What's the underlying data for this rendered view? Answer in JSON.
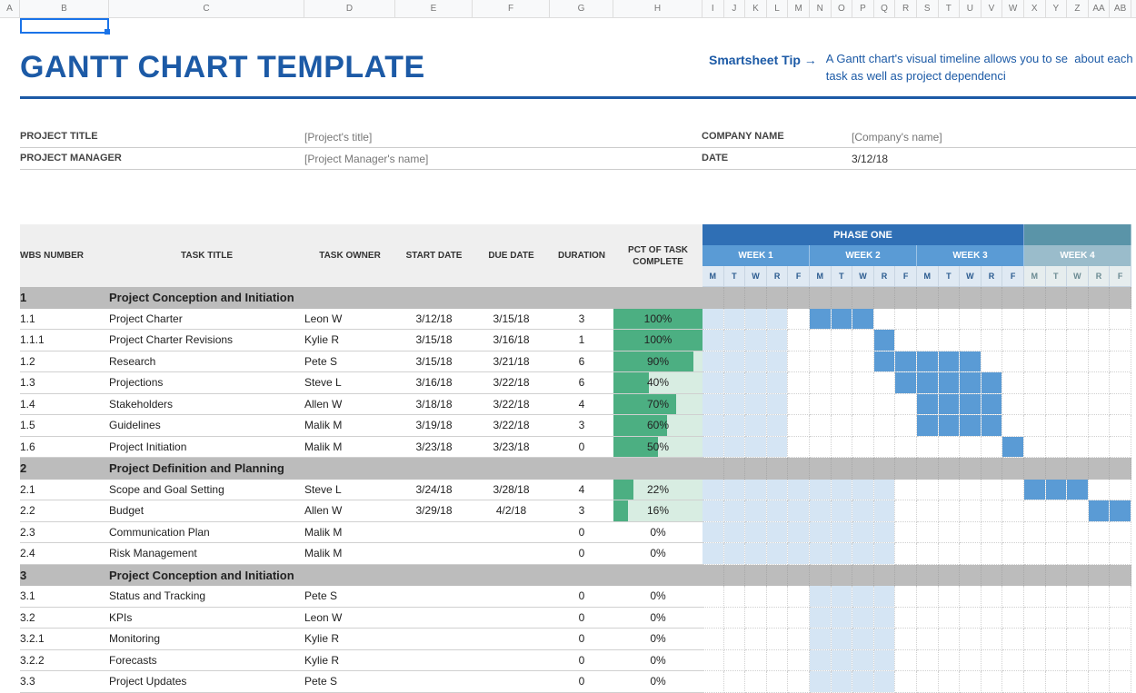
{
  "columns_letters": [
    "A",
    "B",
    "C",
    "D",
    "E",
    "F",
    "G",
    "H",
    "I",
    "J",
    "K",
    "L",
    "M",
    "N",
    "O",
    "P",
    "Q",
    "R",
    "S",
    "T",
    "U",
    "V",
    "W",
    "X",
    "Y",
    "Z",
    "AA",
    "AB"
  ],
  "title": "GANTT CHART TEMPLATE",
  "tip": {
    "label": "Smartsheet Tip",
    "arrow": "→",
    "text": "A Gantt chart's visual timeline allows you to se  about each task as well as project dependenci"
  },
  "meta": {
    "project_title_label": "PROJECT TITLE",
    "project_title_value": "[Project's title]",
    "project_manager_label": "PROJECT MANAGER",
    "project_manager_value": "[Project Manager's name]",
    "company_name_label": "COMPANY NAME",
    "company_name_value": "[Company's name]",
    "date_label": "DATE",
    "date_value": "3/12/18"
  },
  "headers": {
    "wbs": "WBS NUMBER",
    "task": "TASK TITLE",
    "owner": "TASK OWNER",
    "start": "START DATE",
    "due": "DUE DATE",
    "duration": "DURATION",
    "pct": "PCT OF TASK COMPLETE"
  },
  "timeline": {
    "phase_one": "PHASE ONE",
    "weeks": [
      "WEEK 1",
      "WEEK 2",
      "WEEK 3",
      "WEEK 4"
    ],
    "days": [
      "M",
      "T",
      "W",
      "R",
      "F",
      "M",
      "T",
      "W",
      "R",
      "F",
      "M",
      "T",
      "W",
      "R",
      "F",
      "M",
      "T",
      "W",
      "R",
      "F"
    ]
  },
  "chart_data": {
    "type": "gantt",
    "sections": [
      {
        "wbs": "1",
        "title": "Project Conception and Initiation",
        "tasks": [
          {
            "wbs": "1.1",
            "title": "Project Charter",
            "owner": "Leon W",
            "start": "3/12/18",
            "due": "3/15/18",
            "duration": 3,
            "pct": 100,
            "bar_start": 0,
            "bar_len": 4,
            "selected_start": 5,
            "selected_len": 3
          },
          {
            "wbs": "1.1.1",
            "title": "Project Charter Revisions",
            "owner": "Kylie R",
            "start": "3/15/18",
            "due": "3/16/18",
            "duration": 1,
            "pct": 100,
            "bar_start": 0,
            "bar_len": 4,
            "selected_start": 8,
            "selected_len": 1
          },
          {
            "wbs": "1.2",
            "title": "Research",
            "owner": "Pete S",
            "start": "3/15/18",
            "due": "3/21/18",
            "duration": 6,
            "pct": 90,
            "bar_start": 0,
            "bar_len": 4,
            "selected_start": 8,
            "selected_len": 5
          },
          {
            "wbs": "1.3",
            "title": "Projections",
            "owner": "Steve L",
            "start": "3/16/18",
            "due": "3/22/18",
            "duration": 6,
            "pct": 40,
            "bar_start": 0,
            "bar_len": 4,
            "selected_start": 9,
            "selected_len": 5
          },
          {
            "wbs": "1.4",
            "title": "Stakeholders",
            "owner": "Allen W",
            "start": "3/18/18",
            "due": "3/22/18",
            "duration": 4,
            "pct": 70,
            "bar_start": 0,
            "bar_len": 4,
            "selected_start": 10,
            "selected_len": 4
          },
          {
            "wbs": "1.5",
            "title": "Guidelines",
            "owner": "Malik M",
            "start": "3/19/18",
            "due": "3/22/18",
            "duration": 3,
            "pct": 60,
            "bar_start": 0,
            "bar_len": 4,
            "selected_start": 10,
            "selected_len": 4
          },
          {
            "wbs": "1.6",
            "title": "Project Initiation",
            "owner": "Malik M",
            "start": "3/23/18",
            "due": "3/23/18",
            "duration": 0,
            "pct": 50,
            "bar_start": 0,
            "bar_len": 4,
            "selected_start": 14,
            "selected_len": 1
          }
        ]
      },
      {
        "wbs": "2",
        "title": "Project Definition and Planning",
        "tasks": [
          {
            "wbs": "2.1",
            "title": "Scope and Goal Setting",
            "owner": "Steve L",
            "start": "3/24/18",
            "due": "3/28/18",
            "duration": 4,
            "pct": 22,
            "bar_start": 0,
            "bar_len": 9,
            "selected_start": 15,
            "selected_len": 3
          },
          {
            "wbs": "2.2",
            "title": "Budget",
            "owner": "Allen W",
            "start": "3/29/18",
            "due": "4/2/18",
            "duration": 3,
            "pct": 16,
            "bar_start": 0,
            "bar_len": 9,
            "selected_start": 18,
            "selected_len": 2
          },
          {
            "wbs": "2.3",
            "title": "Communication Plan",
            "owner": "Malik M",
            "start": "",
            "due": "",
            "duration": 0,
            "pct": 0,
            "bar_start": 0,
            "bar_len": 9,
            "selected_start": -1,
            "selected_len": 0
          },
          {
            "wbs": "2.4",
            "title": "Risk Management",
            "owner": "Malik M",
            "start": "",
            "due": "",
            "duration": 0,
            "pct": 0,
            "bar_start": 0,
            "bar_len": 9,
            "selected_start": -1,
            "selected_len": 0
          }
        ]
      },
      {
        "wbs": "3",
        "title": "Project Conception and Initiation",
        "tasks": [
          {
            "wbs": "3.1",
            "title": "Status and Tracking",
            "owner": "Pete S",
            "start": "",
            "due": "",
            "duration": 0,
            "pct": 0,
            "bar_start": 5,
            "bar_len": 4,
            "selected_start": -1,
            "selected_len": 0
          },
          {
            "wbs": "3.2",
            "title": "KPIs",
            "owner": "Leon W",
            "start": "",
            "due": "",
            "duration": 0,
            "pct": 0,
            "bar_start": 5,
            "bar_len": 4,
            "selected_start": -1,
            "selected_len": 0
          },
          {
            "wbs": "3.2.1",
            "title": "Monitoring",
            "owner": "Kylie R",
            "start": "",
            "due": "",
            "duration": 0,
            "pct": 0,
            "bar_start": 5,
            "bar_len": 4,
            "selected_start": -1,
            "selected_len": 0
          },
          {
            "wbs": "3.2.2",
            "title": "Forecasts",
            "owner": "Kylie R",
            "start": "",
            "due": "",
            "duration": 0,
            "pct": 0,
            "bar_start": 5,
            "bar_len": 4,
            "selected_start": -1,
            "selected_len": 0
          },
          {
            "wbs": "3.3",
            "title": "Project Updates",
            "owner": "Pete S",
            "start": "",
            "due": "",
            "duration": 0,
            "pct": 0,
            "bar_start": 5,
            "bar_len": 4,
            "selected_start": -1,
            "selected_len": 0
          }
        ]
      }
    ]
  }
}
